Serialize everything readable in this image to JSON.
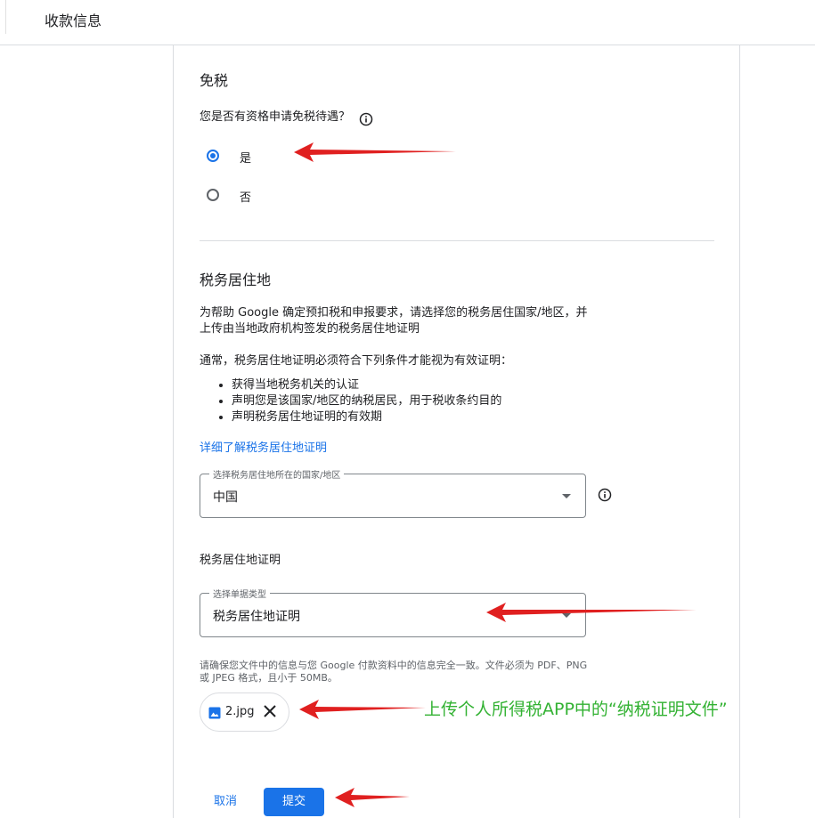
{
  "header": {
    "title": "收款信息"
  },
  "tax_exempt": {
    "heading": "免税",
    "question": "您是否有资格申请免税待遇？",
    "options": [
      {
        "label": "是",
        "selected": true
      },
      {
        "label": "否",
        "selected": false
      }
    ]
  },
  "residence": {
    "heading": "税务居住地",
    "intro_line1": "为帮助 Google 确定预扣税和申报要求，请选择您的税务居住国家/地区，并",
    "intro_line2": "上传由当地政府机构签发的税务居住地证明",
    "conditions_intro": "通常，税务居住地证明必须符合下列条件才能视为有效证明：",
    "conditions": [
      "获得当地税务机关的认证",
      "声明您是该国家/地区的纳税居民，用于税收条约目的",
      "声明税务居住地证明的有效期"
    ],
    "learn_more": "详细了解税务居住地证明",
    "country_field": {
      "label": "选择税务居住地所在的国家/地区",
      "value": "中国"
    },
    "certificate_heading": "税务居住地证明",
    "doc_type_field": {
      "label": "选择单据类型",
      "value": "税务居住地证明"
    },
    "upload_note_line1": "请确保您文件中的信息与您 Google 付款资料中的信息完全一致。文件必须为 PDF、PNG",
    "upload_note_line2": "或 JPEG 格式，且小于 50MB。",
    "file_chip": {
      "name": "2.jpg"
    }
  },
  "actions": {
    "cancel": "取消",
    "submit": "提交"
  },
  "annotation": {
    "note": "上传个人所得税APP中的“纳税证明文件”",
    "arrow_color": "#e02020",
    "note_color": "#33b233"
  },
  "colors": {
    "accent": "#1a73e8",
    "border": "#dadce0"
  }
}
